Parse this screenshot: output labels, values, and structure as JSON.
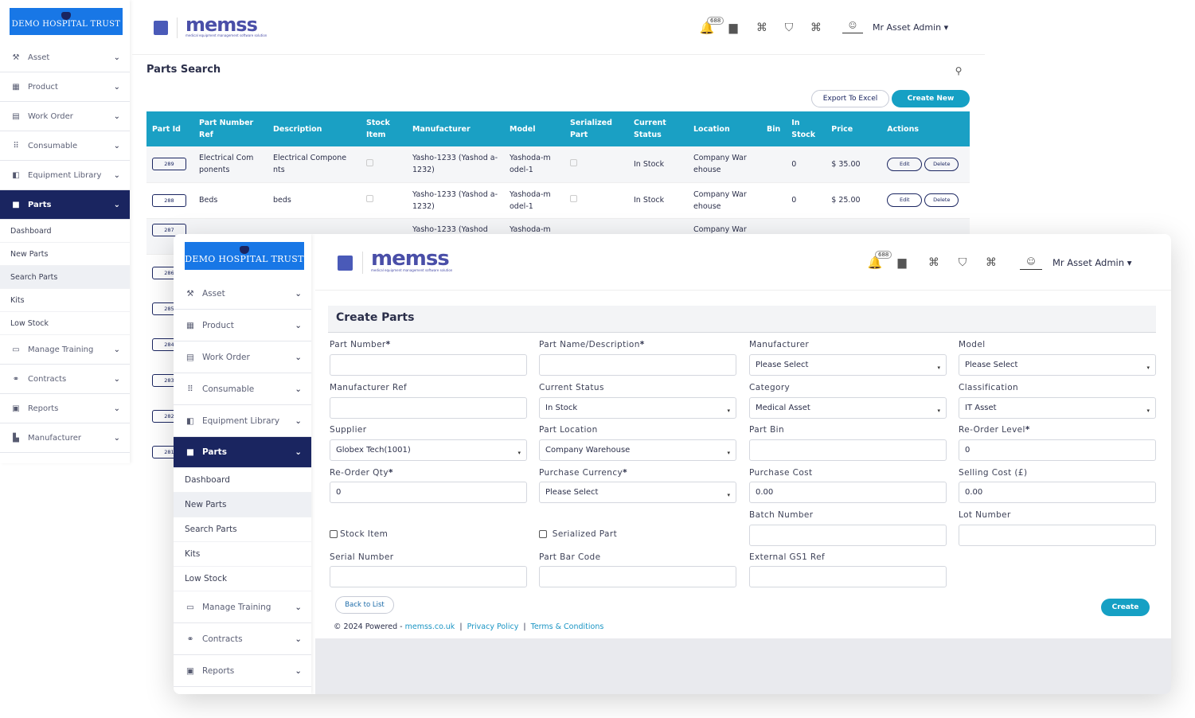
{
  "brand": {
    "hospital": "DEMO HOSPITAL TRUST",
    "logo": "memss",
    "tagline": "medical equipment management software solution"
  },
  "notifications": {
    "count": "688"
  },
  "user": {
    "name": "Mr Asset Admin"
  },
  "nav": {
    "items": [
      {
        "label": "Asset",
        "icon": "asset-icon"
      },
      {
        "label": "Product",
        "icon": "product-icon"
      },
      {
        "label": "Work Order",
        "icon": "work-order-icon"
      },
      {
        "label": "Consumable",
        "icon": "consumable-icon"
      },
      {
        "label": "Equipment Library",
        "icon": "equipment-library-icon"
      },
      {
        "label": "Parts",
        "icon": "parts-icon"
      }
    ],
    "parts_sub": [
      "Dashboard",
      "New Parts",
      "Search Parts",
      "Kits",
      "Low Stock"
    ],
    "after": [
      {
        "label": "Manage Training",
        "icon": "training-icon"
      },
      {
        "label": "Contracts",
        "icon": "contracts-icon"
      },
      {
        "label": "Reports",
        "icon": "reports-icon"
      },
      {
        "label": "Manufacturer",
        "icon": "manufacturer-icon"
      }
    ]
  },
  "search": {
    "title": "Parts Search",
    "export_label": "Export To Excel",
    "create_label": "Create New",
    "columns": [
      "Part Id",
      "Part Number Ref",
      "Description",
      "Stock Item",
      "Manufacturer",
      "Model",
      "Serialized Part",
      "Current Status",
      "Location",
      "Bin",
      "In Stock",
      "Price",
      "Actions"
    ],
    "rows": [
      {
        "id": "289",
        "part_ref": "Electrical Com ponents",
        "desc": "Electrical Compone nts",
        "manufacturer": "Yasho-1233 (Yashod a-1232)",
        "model": "Yashoda-m odel-1",
        "status": "In Stock",
        "location": "Company War ehouse",
        "in_stock": "0",
        "price": "$ 35.00"
      },
      {
        "id": "288",
        "part_ref": "Beds",
        "desc": "beds",
        "manufacturer": "Yasho-1233 (Yashod a-1232)",
        "model": "Yashoda-m odel-1",
        "status": "In Stock",
        "location": "Company War ehouse",
        "in_stock": "0",
        "price": "$ 25.00"
      },
      {
        "id": "287",
        "part_ref": "",
        "desc": "",
        "manufacturer": "Yasho-1233 (Yashod",
        "model": "Yashoda-m",
        "status": "",
        "location": "Company War",
        "in_stock": "",
        "price": ""
      }
    ],
    "hidden_ids": [
      "286",
      "285",
      "284",
      "283",
      "282",
      "281"
    ],
    "edit_label": "Edit",
    "delete_label": "Delete"
  },
  "form": {
    "title": "Create Parts",
    "fields": {
      "part_number": {
        "label": "Part Number",
        "value": ""
      },
      "part_name": {
        "label": "Part Name/Description",
        "value": ""
      },
      "manufacturer": {
        "label": "Manufacturer",
        "value": "Please Select"
      },
      "model": {
        "label": "Model",
        "value": "Please Select"
      },
      "manufacturer_ref": {
        "label": "Manufacturer Ref",
        "value": ""
      },
      "current_status": {
        "label": "Current Status",
        "value": "In Stock"
      },
      "category": {
        "label": "Category",
        "value": "Medical Asset"
      },
      "classification": {
        "label": "Classification",
        "value": "IT Asset"
      },
      "supplier": {
        "label": "Supplier",
        "value": "Globex Tech(1001)"
      },
      "part_location": {
        "label": "Part Location",
        "value": "Company Warehouse"
      },
      "part_bin": {
        "label": "Part Bin",
        "value": ""
      },
      "reorder_level": {
        "label": "Re-Order Level",
        "value": "0"
      },
      "reorder_qty": {
        "label": "Re-Order Qty",
        "value": "0"
      },
      "purchase_currency": {
        "label": "Purchase Currency",
        "value": "Please Select"
      },
      "purchase_cost": {
        "label": "Purchase Cost",
        "value": "0.00"
      },
      "selling_cost": {
        "label": "Selling Cost (£)",
        "value": "0.00"
      },
      "batch_number": {
        "label": "Batch Number",
        "value": ""
      },
      "lot_number": {
        "label": "Lot Number",
        "value": ""
      },
      "serial_number": {
        "label": "Serial Number",
        "value": ""
      },
      "part_bar_code": {
        "label": "Part Bar Code",
        "value": ""
      },
      "external_gs1": {
        "label": "External GS1 Ref",
        "value": ""
      }
    },
    "stock_item_label": "Stock Item",
    "serialized_label": "Serialized Part",
    "back_label": "Back to List",
    "create_label": "Create"
  },
  "footer": {
    "copyright": "© 2024 Powered -",
    "site": "memss.co.uk",
    "privacy": "Privacy Policy",
    "terms": "Terms & Conditions",
    "sep": "|"
  }
}
